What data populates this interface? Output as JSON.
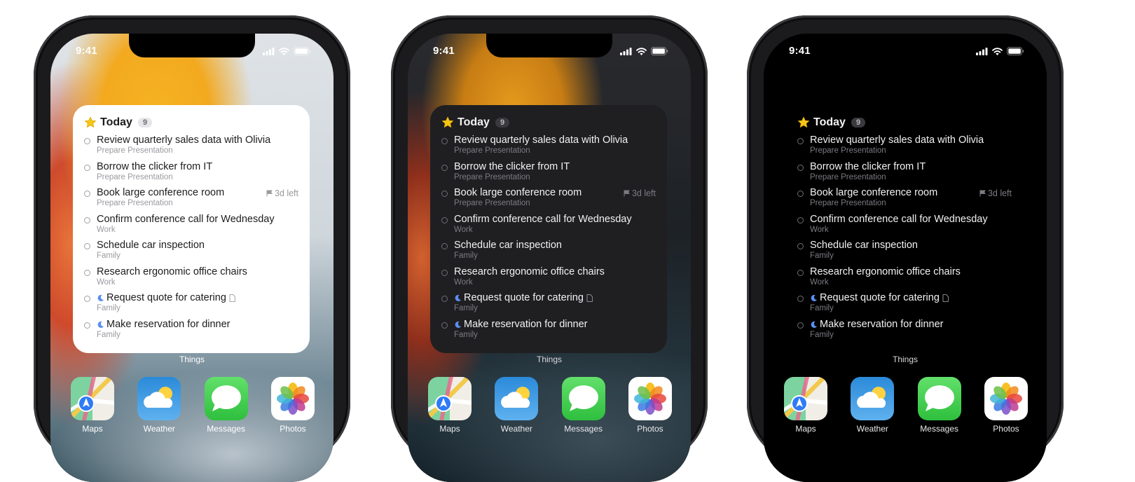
{
  "status": {
    "time": "9:41"
  },
  "widget": {
    "title": "Today",
    "count": "9",
    "tasks": [
      {
        "title": "Review quarterly sales data with Olivia",
        "project": "Prepare Presentation",
        "evening": false,
        "note": false,
        "deadline": ""
      },
      {
        "title": "Borrow the clicker from IT",
        "project": "Prepare Presentation",
        "evening": false,
        "note": false,
        "deadline": ""
      },
      {
        "title": "Book large conference room",
        "project": "Prepare Presentation",
        "evening": false,
        "note": false,
        "deadline": "3d left"
      },
      {
        "title": "Confirm conference call for Wednesday",
        "project": "Work",
        "evening": false,
        "note": false,
        "deadline": ""
      },
      {
        "title": "Schedule car inspection",
        "project": "Family",
        "evening": false,
        "note": false,
        "deadline": ""
      },
      {
        "title": "Research ergonomic office chairs",
        "project": "Work",
        "evening": false,
        "note": false,
        "deadline": ""
      },
      {
        "title": "Request quote for catering",
        "project": "Family",
        "evening": true,
        "note": true,
        "deadline": ""
      },
      {
        "title": "Make reservation for dinner",
        "project": "Family",
        "evening": true,
        "note": false,
        "deadline": ""
      }
    ]
  },
  "widget_label": "Things",
  "dock": [
    {
      "label": "Maps",
      "icon": "maps-icon"
    },
    {
      "label": "Weather",
      "icon": "weather-icon"
    },
    {
      "label": "Messages",
      "icon": "messages-icon"
    },
    {
      "label": "Photos",
      "icon": "photos-icon"
    }
  ],
  "colors": {
    "star": "#f5c518",
    "moon": "#5b8ff0",
    "light_text": "#1c1c1e",
    "dark_text": "#f2f2f4"
  }
}
